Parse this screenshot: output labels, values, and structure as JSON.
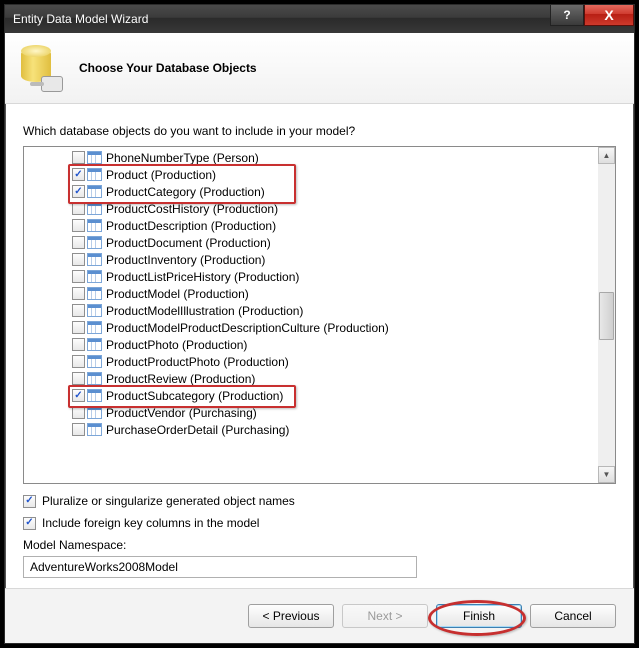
{
  "window": {
    "title": "Entity Data Model Wizard"
  },
  "header": {
    "heading": "Choose Your Database Objects"
  },
  "prompt": "Which database objects do you want to include in your model?",
  "tree": {
    "items": [
      {
        "label": "PhoneNumberType (Person)",
        "checked": false,
        "highlight": false
      },
      {
        "label": "Product (Production)",
        "checked": true,
        "highlight": true
      },
      {
        "label": "ProductCategory (Production)",
        "checked": true,
        "highlight": true
      },
      {
        "label": "ProductCostHistory (Production)",
        "checked": false,
        "highlight": false
      },
      {
        "label": "ProductDescription (Production)",
        "checked": false,
        "highlight": false
      },
      {
        "label": "ProductDocument (Production)",
        "checked": false,
        "highlight": false
      },
      {
        "label": "ProductInventory (Production)",
        "checked": false,
        "highlight": false
      },
      {
        "label": "ProductListPriceHistory (Production)",
        "checked": false,
        "highlight": false
      },
      {
        "label": "ProductModel (Production)",
        "checked": false,
        "highlight": false
      },
      {
        "label": "ProductModelIllustration (Production)",
        "checked": false,
        "highlight": false
      },
      {
        "label": "ProductModelProductDescriptionCulture (Production)",
        "checked": false,
        "highlight": false
      },
      {
        "label": "ProductPhoto (Production)",
        "checked": false,
        "highlight": false
      },
      {
        "label": "ProductProductPhoto (Production)",
        "checked": false,
        "highlight": false
      },
      {
        "label": "ProductReview (Production)",
        "checked": false,
        "highlight": false
      },
      {
        "label": "ProductSubcategory (Production)",
        "checked": true,
        "highlight": true
      },
      {
        "label": "ProductVendor (Purchasing)",
        "checked": false,
        "highlight": false
      },
      {
        "label": "PurchaseOrderDetail (Purchasing)",
        "checked": false,
        "highlight": false
      }
    ]
  },
  "options": {
    "pluralize": {
      "label": "Pluralize or singularize generated object names",
      "checked": true
    },
    "foreign_keys": {
      "label": "Include foreign key columns in the model",
      "checked": true
    }
  },
  "namespace": {
    "label": "Model Namespace:",
    "value": "AdventureWorks2008Model"
  },
  "buttons": {
    "previous": "< Previous",
    "next": "Next >",
    "finish": "Finish",
    "cancel": "Cancel"
  },
  "titlebar": {
    "help": "?",
    "close": "X"
  }
}
